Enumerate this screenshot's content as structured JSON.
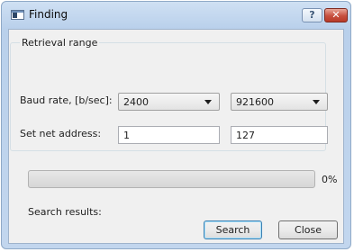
{
  "window": {
    "title": "Finding",
    "help_label": "?",
    "close_label": "✕",
    "app_icon": "window-app-icon"
  },
  "retrieval": {
    "group_title": "Retrieval range",
    "baud_label": "Baud rate, [b/sec]:",
    "baud_from": "2400",
    "baud_to": "921600",
    "address_label": "Set net address:",
    "address_from": "1",
    "address_to": "127"
  },
  "progress": {
    "value": 0,
    "text": "0%"
  },
  "results": {
    "label": "Search results:"
  },
  "buttons": {
    "search": "Search",
    "close": "Close"
  }
}
